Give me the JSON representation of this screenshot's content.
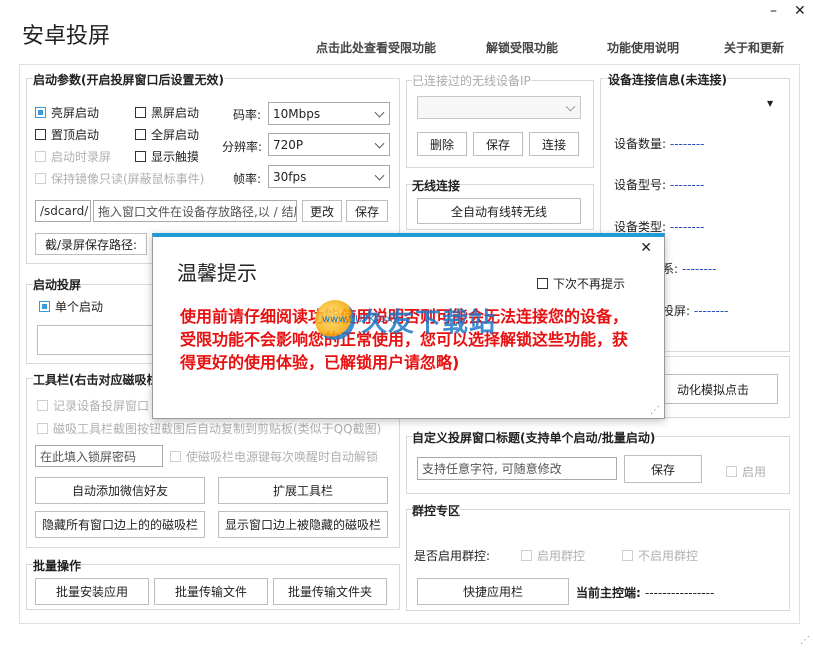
{
  "window": {
    "title": "安卓投屏",
    "min": "–",
    "close": "✕"
  },
  "toplinks": [
    "点击此处查看受限功能",
    "解锁受限功能",
    "功能使用说明",
    "关于和更新"
  ],
  "startup": {
    "title": "启动参数(开启投屏窗口后设置无效)",
    "options": [
      {
        "label": "亮屏启动",
        "checked": true
      },
      {
        "label": "黑屏启动",
        "checked": false
      },
      {
        "label": "置顶启动",
        "checked": false
      },
      {
        "label": "全屏启动",
        "checked": false
      },
      {
        "label": "启动时录屏",
        "checked": false
      },
      {
        "label": "显示触摸",
        "checked": false
      },
      {
        "label": "保持镜像只读(屏蔽鼠标事件)",
        "checked": false
      }
    ],
    "bitrate_label": "码率:",
    "bitrate": "10Mbps",
    "resolution_label": "分辨率:",
    "resolution": "720P",
    "fps_label": "帧率:",
    "fps": "30fps",
    "path_prefix": "/sdcard/",
    "path_placeholder": "拖入窗口文件在设备存放路径,以 / 结尾",
    "change_btn": "更改",
    "save_btn": "保存",
    "record_path_btn": "截/录屏保存路径:"
  },
  "wifi_devices": {
    "title": "已连接过的无线设备IP",
    "delete": "删除",
    "save": "保存",
    "connect": "连接"
  },
  "wireless": {
    "title": "无线连接",
    "auto_btn": "全自动有线转无线"
  },
  "device_info": {
    "title": "设备连接信息(未连接)",
    "rows": [
      {
        "label": "设备数量:",
        "value": "--------"
      },
      {
        "label": "设备型号:",
        "value": "--------"
      },
      {
        "label": "设备类型:",
        "value": "--------"
      },
      {
        "label": "系:",
        "value": "--------"
      },
      {
        "label": "投屏:",
        "value": "--------"
      }
    ]
  },
  "launch": {
    "title": "启动投屏",
    "single": "单个启动"
  },
  "toolbar": {
    "title": "工具栏(右击对应磁吸栏",
    "record_info": "记录设备投屏窗口",
    "clipboard": "磁吸工具栏截图按钮截图后自动复制到剪贴板(类似于QQ截图)",
    "lock_pwd_placeholder": "在此填入锁屏密码",
    "wake_unlock": "使磁吸栏电源键每次唤醒时自动解锁",
    "add_wechat": "自动添加微信好友",
    "extend": "扩展工具栏",
    "hide_all": "隐藏所有窗口边上的的磁吸栏",
    "show_hidden": "显示窗口边上被隐藏的磁吸栏",
    "auto_click": "动化模拟点击"
  },
  "custom_title": {
    "title": "自定义投屏窗口标题(支持单个启动/批量启动)",
    "placeholder": "支持任意字符, 可随意修改",
    "save": "保存",
    "enable": "启用"
  },
  "group_ctrl": {
    "title": "群控专区",
    "question": "是否启用群控:",
    "enable": "启用群控",
    "disable": "不启用群控",
    "shortcut": "快捷应用栏",
    "master_label": "当前主控端:",
    "master_value": "----------------"
  },
  "batch": {
    "title": "批量操作",
    "install": "批量安装应用",
    "transfer_file": "批量传输文件",
    "transfer_folder": "批量传输文件夹"
  },
  "dialog": {
    "title": "温馨提示",
    "close": "✕",
    "no_more": "下次不再提示",
    "message": "使用前请仔细阅读功能使用说明否则可能会无法连接您的设备，受限功能不会影响您的正常使用，您可以选择解锁这些功能，获得更好的使用体验，已解锁用户请忽略)"
  },
  "watermark": {
    "text": "久友下载站",
    "url": "www.9UPK.com"
  }
}
